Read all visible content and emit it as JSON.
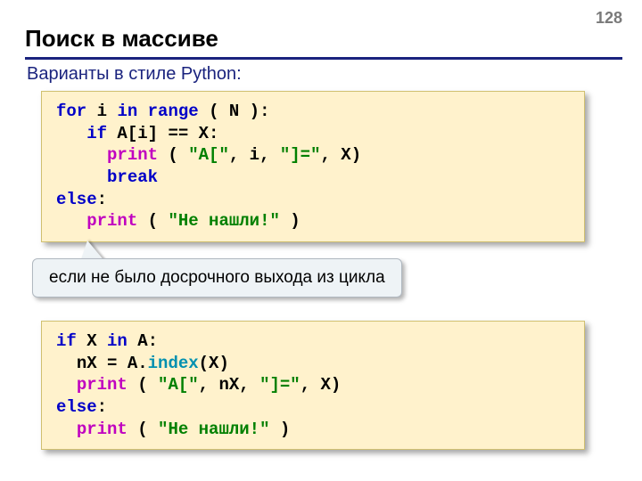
{
  "page_number": "128",
  "title": "Поиск в массиве",
  "subtitle": "Варианты в стиле Python:",
  "callout": "если не было досрочного выхода из цикла",
  "code1": {
    "l1": {
      "for": "for",
      "i": "i",
      "in": "in",
      "range": "range",
      "rest": " ( N ):"
    },
    "l2": {
      "pad": "   ",
      "if": "if",
      "cond": " A[i] == X:"
    },
    "l3": {
      "pad": "     ",
      "print": "print",
      "open": " ( ",
      "s1": "\"A[\"",
      "c1": ", i, ",
      "s2": "\"]=\"",
      "c2": ", X)"
    },
    "l4": {
      "pad": "     ",
      "break": "break"
    },
    "l5": {
      "else": "else",
      "colon": ":"
    },
    "l6": {
      "pad": "   ",
      "print": "print",
      "open": " ( ",
      "s1": "\"Не нашли!\"",
      "close": " )"
    }
  },
  "code2": {
    "l1": {
      "if": "if",
      "x": " X ",
      "in": "in",
      "a": " A:"
    },
    "l2": {
      "pad": "  ",
      "lhs": "nX = A.",
      "index": "index",
      "rhs": "(X)"
    },
    "l3": {
      "pad": "  ",
      "print": "print",
      "open": " ( ",
      "s1": "\"A[\"",
      "c1": ", nX, ",
      "s2": "\"]=\"",
      "c2": ", X)"
    },
    "l4": {
      "else": "else",
      "colon": ":"
    },
    "l5": {
      "pad": "  ",
      "print": "print",
      "open": " ( ",
      "s1": "\"Не нашли!\"",
      "close": " )"
    }
  }
}
